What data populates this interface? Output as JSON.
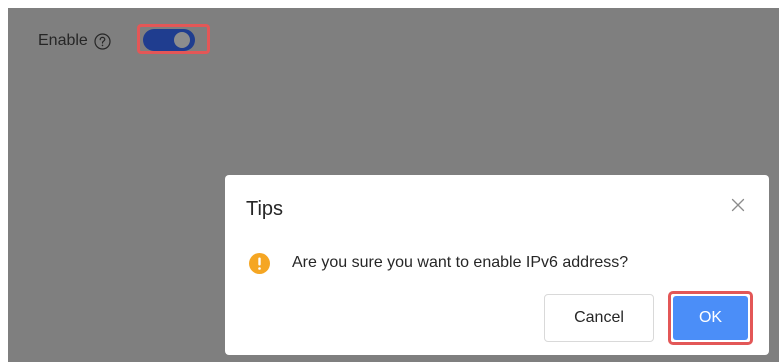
{
  "settings": {
    "enable_label": "Enable",
    "help_icon": "question-circle-icon",
    "toggle_state": "on",
    "accent_color": "#1f3d8f"
  },
  "dialog": {
    "title": "Tips",
    "close_icon": "close-icon",
    "warning_icon": "exclamation-circle-icon",
    "message": "Are you sure you want to enable IPv6 address?",
    "cancel_label": "Cancel",
    "ok_label": "OK",
    "ok_color": "#4b8ef8",
    "highlight_color": "#e35757"
  }
}
